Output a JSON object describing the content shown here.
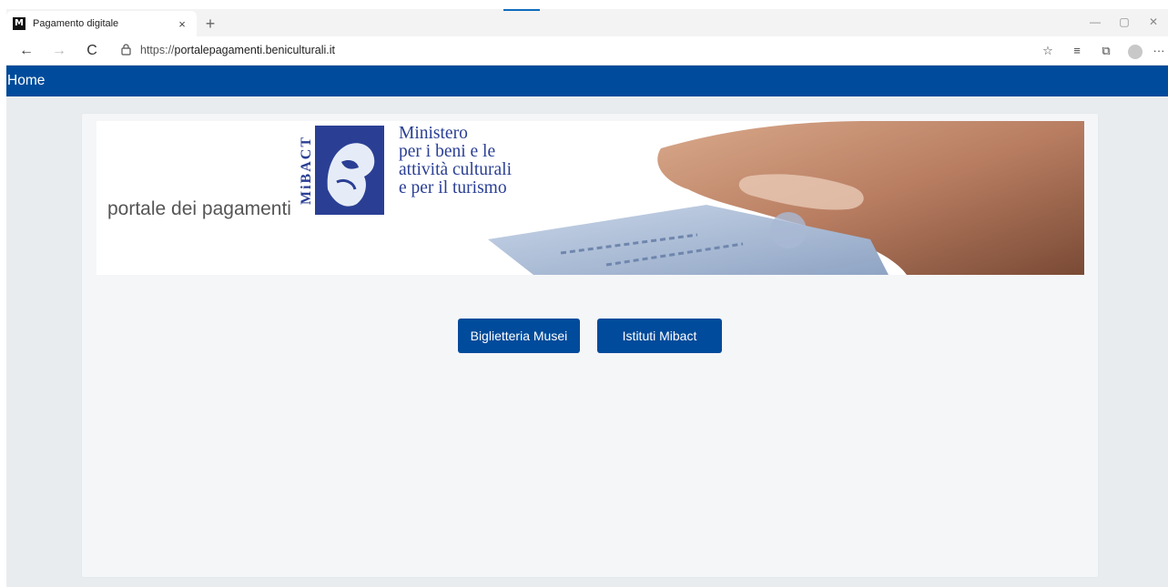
{
  "browser": {
    "tab": {
      "title": "Pagamento digitale",
      "favicon_glyph": "M",
      "close_label": "×"
    },
    "new_tab_label": "+",
    "window_controls": {
      "minimize": "—",
      "maximize": "▢",
      "close": "✕"
    },
    "nav": {
      "back": "←",
      "forward": "→",
      "refresh": "C"
    },
    "address": {
      "scheme": "https://",
      "host": "portalepagamenti.beniculturali.it"
    },
    "tools": {
      "favorites_icon": "☆",
      "collections_icon": "≡",
      "extensions_icon": "⧉",
      "more": "···"
    }
  },
  "site_nav": {
    "home_label": "Home"
  },
  "banner": {
    "portal_text": "portale dei pagamenti",
    "logo_text": "MiBACT",
    "ministry_lines": [
      "Ministero",
      "per i beni e le",
      "attività culturali",
      "e per il turismo"
    ]
  },
  "actions": {
    "biglietteria_label": "Biglietteria Musei",
    "istituti_label": "Istituti Mibact"
  },
  "colors": {
    "brand_blue": "#004b9b",
    "ministry_blue": "#2a3f94",
    "page_bg": "#e9ecef",
    "card_bg": "#f5f6f8"
  }
}
